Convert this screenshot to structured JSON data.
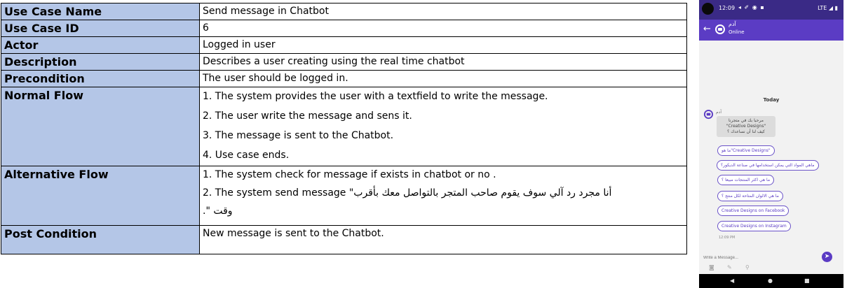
{
  "table": {
    "rows": [
      {
        "label": "Use Case Name",
        "value": "Send message in Chatbot"
      },
      {
        "label": "Use Case ID",
        "value": "6"
      },
      {
        "label": "Actor",
        "value": "Logged in user"
      },
      {
        "label": "Description",
        "value": "Describes a user creating using the real time chatbot"
      },
      {
        "label": "Precondition",
        "value": "The user should be logged in."
      }
    ],
    "normal_flow": {
      "label": "Normal Flow",
      "steps": [
        "1. The system provides the user with a textfield to write the message.",
        "2. The user write the message and sens it.",
        "3. The message is sent to the Chatbot.",
        "4. Use case ends."
      ]
    },
    "alternative_flow": {
      "label": "Alternative Flow",
      "line1": "1.  The system check for message if exists in chatbot or no .",
      "line2_prefix": "2.  The system send message \"",
      "line2_arabic": "أنا مجرد رد آلي سوف يقوم صاحب المتجر بالتواصل معك بأقرب",
      "line3": "وقت \"."
    },
    "post_condition": {
      "label": "Post Condition",
      "value": "New message is sent to the Chatbot."
    }
  },
  "phone": {
    "status_time": "12:09",
    "status_icons": "◂ ✐ ◉ ▪",
    "status_right": "LTE ◢ ▮",
    "contact_name": "آدم",
    "contact_status": "Online",
    "date_divider": "Today",
    "sender_name": "آدم",
    "bot_message_line1": "مرحبا بك في متجرنا",
    "bot_message_line2": "\"Creative Designs\"",
    "bot_message_line3": "كيف لنا أن نساعدك ؟",
    "options": [
      "ما هو\"Creative Designs\"",
      "ماهي المواد التي يمكن استخدامها في صناعة الديكور؟",
      "ما هي اكثر المنتجات مبيعا ؟",
      "ما هي الالوان المتاحة لكل منتج ؟",
      "Creative Designs on Facebook",
      "Creative Designs on Instagram"
    ],
    "message_time": "12:09 PM",
    "input_placeholder": "Write a Message...",
    "colors": {
      "primary": "#5b3cc4",
      "status_bar": "#3a2a86",
      "label_bg": "#b4c6e7"
    }
  }
}
